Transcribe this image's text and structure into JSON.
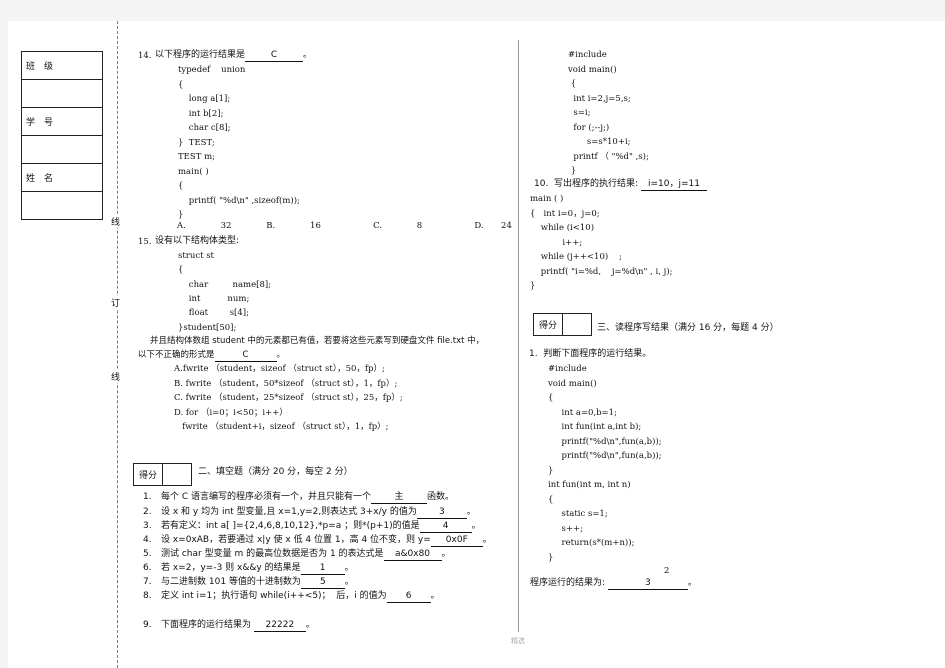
{
  "student_info": {
    "rows": [
      {
        "label": "班　级",
        "value": ""
      },
      {
        "label": "学　号",
        "value": ""
      },
      {
        "label": "姓　名",
        "value": ""
      }
    ]
  },
  "binding_line": [
    "线",
    "订",
    "线"
  ],
  "left_column": {
    "q14": {
      "number": "14.",
      "text": "以下程序的运行结果是",
      "answer": "C",
      "end": "。",
      "code": [
        "typedef    union",
        "{",
        "    long a[1];",
        "    int b[2];",
        "    char c[8];",
        "}  TEST;",
        "TEST m;",
        "main( )",
        "{",
        "    printf( \"%d\\n\" ,sizeof(m));",
        "}"
      ],
      "options": [
        "A.    32",
        "B.    16",
        "C.    8",
        "D.  24"
      ]
    },
    "q15": {
      "number": "15.",
      "text": "设有以下结构体类型:",
      "code": [
        "struct st",
        "{",
        "    char         name[8];",
        "    int          num;",
        "    float        s[4];",
        "}student[50];"
      ],
      "desc1": "并且结构体数组 student 中的元素都已有值，若要将这些元素写到硬盘文件 file.txt 中，",
      "desc2": "以下不正确的形式是",
      "answer": "C",
      "end": "。",
      "options": [
        "A.fwrite （student，sizeof （struct st），50，fp）;",
        "B. fwrite （student，50*sizeof （struct st），1，fp）;",
        "C. fwrite （student，25*sizeof （struct st），25，fp）;",
        "D. for （i=0；i<50；i++）",
        "   fwrite （student+i，sizeof （struct st），1，fp）;"
      ]
    },
    "section2": {
      "score_label": "得分",
      "score_value": "",
      "title": "二、填空题（满分 20 分，每空 2 分）",
      "items": [
        {
          "n": "1.",
          "pre": "每个 C 语言编写的程序必须有一个，并且只能有一个",
          "ans": "主",
          "post": "函数。"
        },
        {
          "n": "2.",
          "pre": "设 x 和 y 均为 int 型变量,且 x=1,y=2,则表达式 3+x/y 的值为",
          "ans": "3",
          "post": "。"
        },
        {
          "n": "3.",
          "pre": "若有定义：int a[ ]={2,4,6,8,10,12},*p=a ；则*(p+1)的值是",
          "ans": "4",
          "post": "。"
        },
        {
          "n": "4.",
          "pre": "设 x=0xAB，若要通过 x|y 使 x 低 4 位置 1，高 4 位不变，则 y=",
          "ans": "0x0F",
          "post": "。"
        },
        {
          "n": "5.",
          "pre": "测试 char 型变量 m 的最高位数据是否为 1 的表达式是",
          "ans": "a&0x80",
          "post": "。"
        },
        {
          "n": "6.",
          "pre": "若 x=2，y=-3 则 x&&y 的结果是",
          "ans": "1",
          "post": "。"
        },
        {
          "n": "7.",
          "pre": "与二进制数 101 等值的十进制数为",
          "ans": "5",
          "post": "。"
        },
        {
          "n": "8.",
          "pre": "定义 int i=1；执行语句 while(i++<5)；  后，i 的值为",
          "ans": "6",
          "post": "。"
        },
        {
          "n": "9.",
          "pre": "下面程序的运行结果为 ",
          "ans": "22222",
          "post": "。"
        }
      ]
    }
  },
  "right_column": {
    "q9_code": [
      "#include",
      "void main()",
      " {",
      "  int i=2,j=5,s;",
      "  s=i;",
      "  for (;--j;)",
      "       s=s*10+i;",
      "  printf （ \"%d\" ,s);",
      " }"
    ],
    "q10": {
      "text": "10.  写出程序的执行结果:",
      "answer": "i=10，j=11",
      "code": [
        "main ( )",
        "{   int i=0，j=0;",
        "    while (i<10)",
        "            i++;",
        "    while (j++<10)    ;",
        "    printf( \"i=%d,    j=%d\\n\" , i, j);",
        "}"
      ]
    },
    "section3": {
      "score_label": "得分",
      "score_value": "",
      "title": "三、读程序写结果（满分 16 分，每题 4 分）",
      "q1_text": "1.  判断下面程序的运行结果。",
      "code": [
        "#include",
        "void main()",
        "{",
        "     int a=0,b=1;",
        "     int fun(int a,int b);",
        "     printf(\"%d\\n\",fun(a,b));",
        "     printf(\"%d\\n\",fun(a,b));",
        "}",
        "int fun(int m, int n)",
        "{",
        "     static s=1;",
        "     s++;",
        "     return(s*(m+n));",
        "}"
      ],
      "result_line1": "2",
      "result_label": "程序运行的结果为:",
      "result_answer": "3",
      "result_end": "。"
    }
  },
  "footer": "精选"
}
